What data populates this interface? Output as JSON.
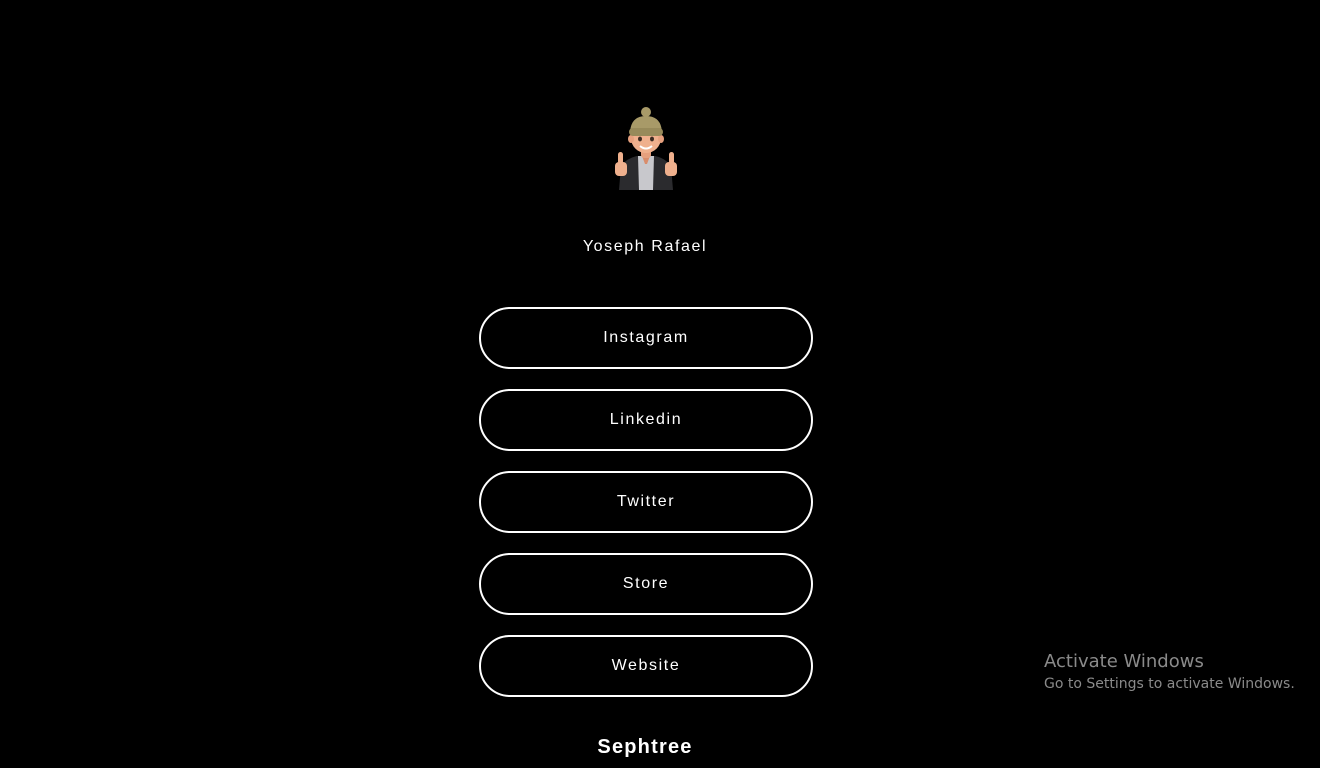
{
  "profile": {
    "avatar_icon": "memoji-thumbs-up-avatar",
    "name": "Yoseph Rafael"
  },
  "links": [
    {
      "label": "Instagram"
    },
    {
      "label": "Linkedin"
    },
    {
      "label": "Twitter"
    },
    {
      "label": "Store"
    },
    {
      "label": "Website"
    }
  ],
  "footer": {
    "brand": "Sephtree"
  },
  "watermark": {
    "title": "Activate Windows",
    "subtitle": "Go to Settings to activate Windows."
  },
  "colors": {
    "background": "#000000",
    "text": "#ffffff",
    "button_border": "#ffffff",
    "watermark": "#8a8a8a"
  }
}
